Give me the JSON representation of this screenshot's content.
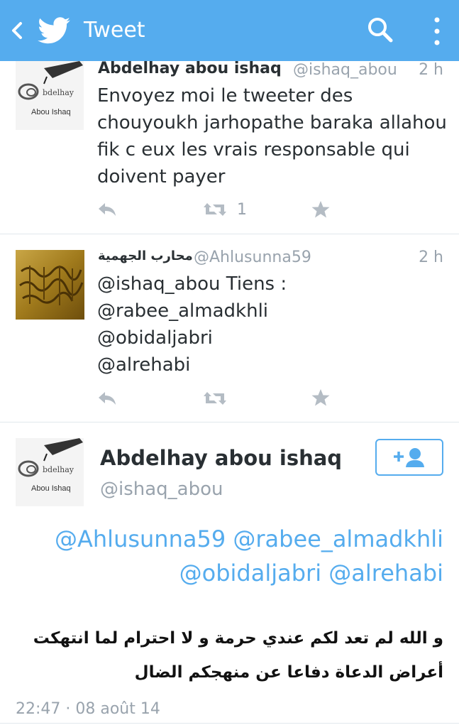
{
  "header": {
    "title": "Tweet",
    "color": "#55acee",
    "icons": [
      "back-icon",
      "twitter-bird-icon",
      "search-icon",
      "more-icon"
    ]
  },
  "tweets": [
    {
      "name": "Abdelhay abou ishaq",
      "handle": "@ishaq_abou",
      "time": "2 h",
      "text_lines": [
        "Envoyez moi le tweeter des",
        "chouyoukh jarhopathe baraka allahou",
        "fik c eux les vrais responsable qui",
        "doivent payer"
      ],
      "retweets": "1",
      "avatar_text": [
        "bdelhay",
        "Abou Ishaq"
      ]
    },
    {
      "name": "محارب الجهمية",
      "handle": "@Ahlusunna59",
      "time": "2 h",
      "text_lines": [
        "@ishaq_abou Tiens :",
        "@rabee_almadkhli",
        "@obidaljabri",
        "@alrehabi"
      ]
    }
  ],
  "main_tweet": {
    "name": "Abdelhay abou ishaq",
    "handle": "@ishaq_abou",
    "avatar_text": [
      "bdelhay",
      "Abou Ishaq"
    ],
    "mentions_line1": "@Ahlusunna59 @rabee_almadkhli",
    "mentions_line2": "@obidaljabri @alrehabi",
    "arabic_line1": "و الله لم تعد لكم عندي حرمة و لا احترام لما انتهكت",
    "arabic_line2": "أعراض الدعاة دفاعا عن منهجكم الضال",
    "timestamp": "22:47 · 08 août 14"
  }
}
